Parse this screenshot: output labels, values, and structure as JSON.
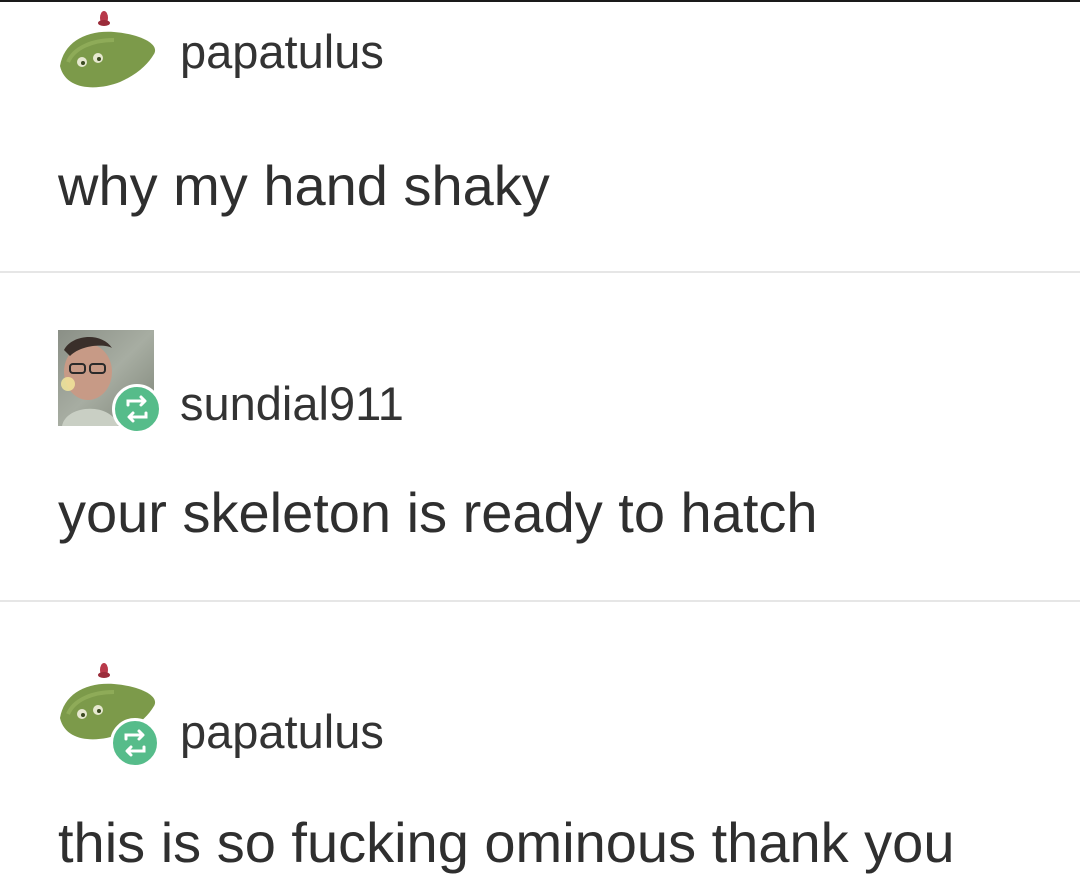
{
  "thread": {
    "posts": [
      {
        "username": "papatulus",
        "body": "why my hand shaky",
        "avatar_icon": "green-blob-avatar-icon",
        "reblog": false
      },
      {
        "username": "sundial911",
        "body": "your skeleton is ready to hatch",
        "avatar_icon": "photo-avatar-icon",
        "reblog": true
      },
      {
        "username": "papatulus",
        "body": "this is so fucking ominous thank you",
        "avatar_icon": "green-blob-avatar-icon",
        "reblog": true
      }
    ]
  },
  "colors": {
    "reblog_badge": "#56bc8a",
    "avatar_green": "#7c9a4a",
    "divider": "#e6e6e6",
    "text": "#2f2f2f"
  }
}
